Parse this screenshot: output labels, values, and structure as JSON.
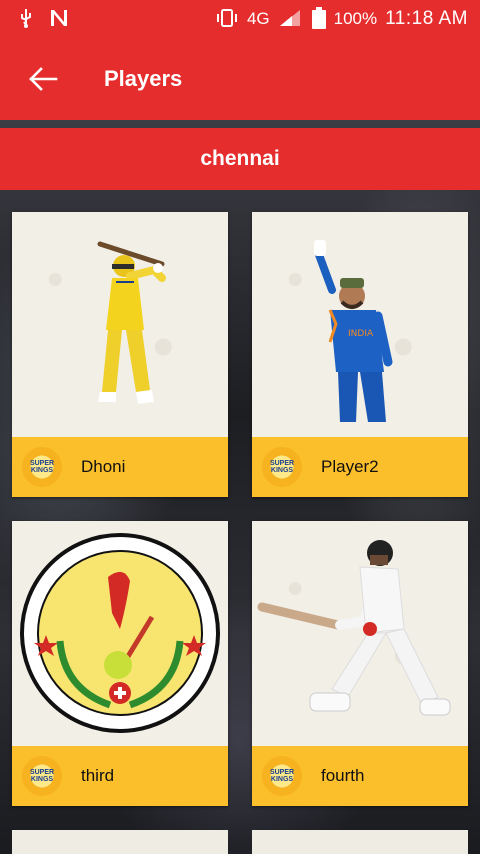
{
  "status_bar": {
    "network": "4G",
    "network_small": "4G",
    "battery": "100%",
    "time": "11:18 AM"
  },
  "app_bar": {
    "title": "Players"
  },
  "section": {
    "title": "chennai"
  },
  "players": [
    {
      "name": "Dhoni",
      "image": "batsman-yellow-jersey"
    },
    {
      "name": "Player2",
      "image": "batsman-blue-jersey-raised-bat"
    },
    {
      "name": "third",
      "image": "circular-emblem"
    },
    {
      "name": "fourth",
      "image": "batsman-white-kit"
    }
  ],
  "colors": {
    "primary": "#e52d2d",
    "card_footer": "#fbbf2b",
    "card_bg": "#f2efe7"
  }
}
